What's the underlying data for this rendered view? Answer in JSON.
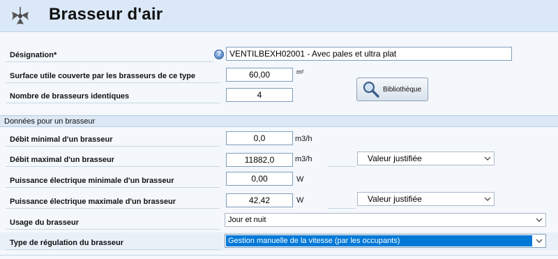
{
  "header": {
    "title": "Brasseur d'air",
    "icon": "ceiling-fan-icon"
  },
  "form": {
    "designation": {
      "label": "Désignation*",
      "value": "VENTILBEXH02001 - Avec pales et ultra plat"
    },
    "surface": {
      "label": "Surface utile couverte par les brasseurs de ce type",
      "value": "60,00",
      "unit": "m²"
    },
    "nombre": {
      "label": "Nombre de brasseurs identiques",
      "value": "4"
    },
    "bibliotheque_label": "Bibliothèque"
  },
  "section": {
    "title": "Données pour un brasseur"
  },
  "unit_form": {
    "debit_min": {
      "label": "Débit minimal d'un brasseur",
      "value": "0,0",
      "unit": "m3/h"
    },
    "debit_max": {
      "label": "Débit maximal d'un brasseur",
      "value": "11882,0",
      "unit": "m3/h",
      "select": "Valeur justifiée"
    },
    "puissance_min": {
      "label": "Puissance électrique minimale d'un brasseur",
      "value": "0,00",
      "unit": "W"
    },
    "puissance_max": {
      "label": "Puissance électrique maximale d'un brasseur",
      "value": "42,42",
      "unit": "W",
      "select": "Valeur justifiée"
    },
    "usage": {
      "label": "Usage du brasseur",
      "value": "Jour et nuit"
    },
    "regulation": {
      "label": "Type de régulation du brasseur",
      "value": "Gestion manuelle de la vitesse (par les occupants)"
    }
  },
  "colors": {
    "header_bg": "#dbe8f7",
    "selection": "#0078d7"
  }
}
